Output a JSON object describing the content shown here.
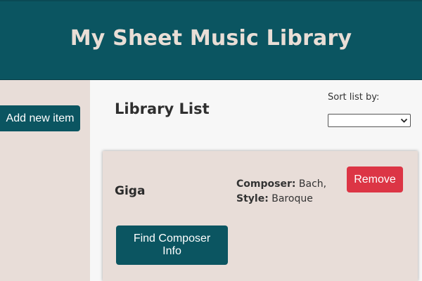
{
  "header": {
    "title": "My Sheet Music Library"
  },
  "sidebar": {
    "add_label": "Add new item"
  },
  "main": {
    "list_title": "Library List",
    "sort": {
      "label": "Sort list by:",
      "selected": ""
    }
  },
  "items": [
    {
      "title": "Giga",
      "composer_label": "Composer:",
      "composer": "Bach,",
      "style_label": "Style:",
      "style": "Baroque",
      "remove_label": "Remove",
      "find_label": "Find Composer Info"
    }
  ],
  "colors": {
    "primary": "#0b5561",
    "danger": "#dc3545",
    "panel": "#e8ddd8",
    "header_text": "#e9ded6"
  },
  "icons": {
    "select_chevron": "chevron-down-icon"
  }
}
